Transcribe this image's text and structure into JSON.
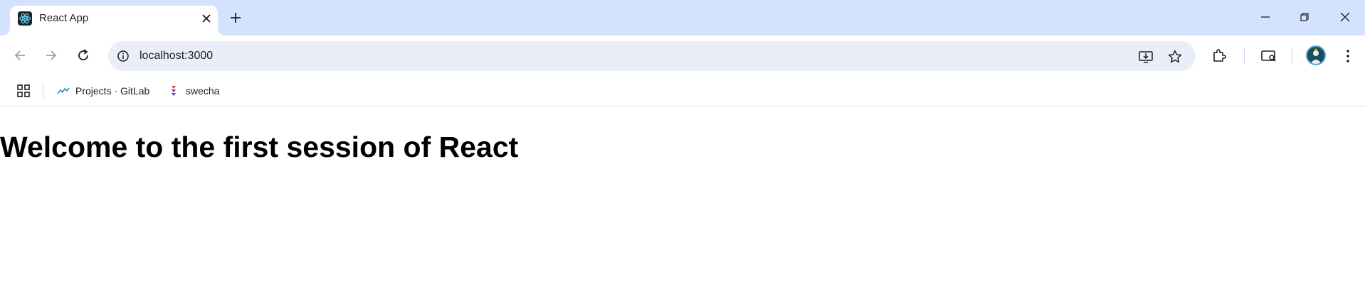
{
  "browser": {
    "tab": {
      "title": "React App",
      "favicon": "react-logo-icon"
    },
    "address_bar": {
      "url": "localhost:3000"
    },
    "bookmarks": [
      {
        "label": "Projects · GitLab",
        "icon": "gitlab-activity-icon"
      },
      {
        "label": "swecha",
        "icon": "swecha-icon"
      }
    ],
    "colors": {
      "titlebar": "#d3e3fd",
      "omnibox": "#e9eef8",
      "react_blue": "#61dafb"
    }
  },
  "page": {
    "heading": "Welcome to the first session of React"
  }
}
